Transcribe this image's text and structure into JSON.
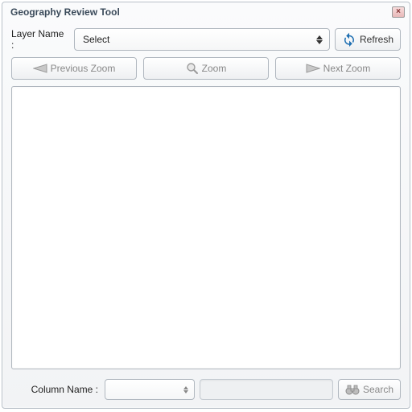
{
  "window": {
    "title": "Geography Review Tool"
  },
  "layer": {
    "label": "Layer Name :",
    "selected": "Select",
    "refresh_label": "Refresh"
  },
  "zoom": {
    "previous": "Previous Zoom",
    "zoom": "Zoom",
    "next": "Next Zoom"
  },
  "search": {
    "column_label": "Column Name :",
    "column_selected": "",
    "input_value": "",
    "button_label": "Search"
  },
  "colors": {
    "panel_border": "#b8c0c8",
    "accent_blue": "#1f6fb2",
    "disabled_text": "#888888"
  }
}
